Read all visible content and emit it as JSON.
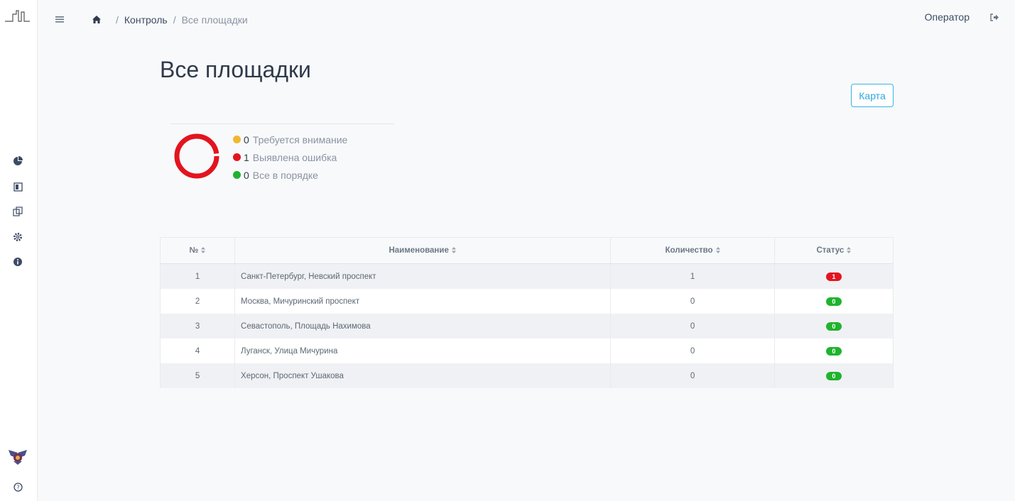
{
  "header": {
    "breadcrumb": {
      "sep1": "/",
      "section": "Контроль",
      "sep2": "/",
      "current": "Все площадки"
    },
    "user": "Оператор"
  },
  "page": {
    "title": "Все площадки",
    "map_button": "Карта"
  },
  "summary": {
    "items": [
      {
        "count": "0",
        "label": "Требуется внимание",
        "color": "#f2b730"
      },
      {
        "count": "1",
        "label": "Выявлена ошибка",
        "color": "#e3141e"
      },
      {
        "count": "0",
        "label": "Все в порядке",
        "color": "#1fb32e"
      }
    ]
  },
  "table": {
    "headers": {
      "num": "№",
      "name": "Наименование",
      "qty": "Количество",
      "status": "Статус"
    },
    "rows": [
      {
        "num": "1",
        "name": "Санкт-Петербург, Невский проспект",
        "qty": "1",
        "status": "1",
        "status_color": "red"
      },
      {
        "num": "2",
        "name": "Москва, Мичуринский проспект",
        "qty": "0",
        "status": "0",
        "status_color": "green"
      },
      {
        "num": "3",
        "name": "Севастополь, Площадь Нахимова",
        "qty": "0",
        "status": "0",
        "status_color": "green"
      },
      {
        "num": "4",
        "name": "Луганск, Улица Мичурина",
        "qty": "0",
        "status": "0",
        "status_color": "green"
      },
      {
        "num": "5",
        "name": "Херсон, Проспект Ушакова",
        "qty": "0",
        "status": "0",
        "status_color": "green"
      }
    ]
  },
  "icons": {
    "sidebar": [
      "logo-icon",
      "pie-chart-icon",
      "dashboard-icon",
      "copy-icon",
      "gear-icon",
      "info-icon",
      "emblem-icon",
      "help-icon"
    ],
    "header": [
      "menu-icon",
      "home-icon",
      "logout-icon"
    ]
  }
}
